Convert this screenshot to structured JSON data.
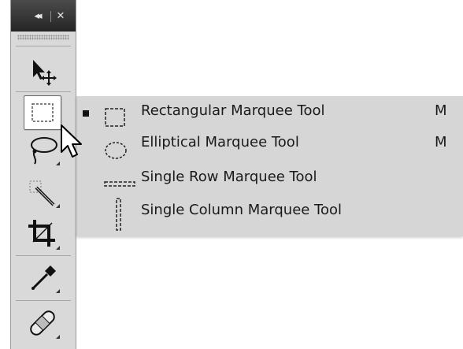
{
  "toolbar": {
    "titlebar": {
      "collapse_glyph": "◂◂",
      "close_glyph": "✕"
    },
    "tools": [
      {
        "name": "move-tool",
        "icon": "move-icon"
      },
      {
        "name": "rectangular-marquee-tool",
        "icon": "rectangular-marquee-icon",
        "active": true
      },
      {
        "name": "lasso-tool",
        "icon": "lasso-icon"
      },
      {
        "name": "magic-wand-tool",
        "icon": "magic-wand-icon"
      },
      {
        "name": "crop-tool",
        "icon": "crop-icon"
      },
      {
        "name": "eyedropper-tool",
        "icon": "eyedropper-icon"
      },
      {
        "name": "healing-brush-tool",
        "icon": "bandage-icon"
      }
    ]
  },
  "flyout": {
    "items": [
      {
        "label": "Rectangular Marquee Tool",
        "shortcut": "M",
        "selected": true,
        "icon": "rectangular-marquee-icon"
      },
      {
        "label": "Elliptical Marquee Tool",
        "shortcut": "M",
        "selected": false,
        "icon": "elliptical-marquee-icon"
      },
      {
        "label": "Single Row Marquee Tool",
        "shortcut": "",
        "selected": false,
        "icon": "single-row-marquee-icon"
      },
      {
        "label": "Single Column Marquee Tool",
        "shortcut": "",
        "selected": false,
        "icon": "single-column-marquee-icon"
      }
    ]
  },
  "colors": {
    "panel_bg": "#d9d9d9",
    "titlebar": "#3a3a3a",
    "flyout_bg": "#d6d6d6",
    "text": "#1a1a1a"
  }
}
